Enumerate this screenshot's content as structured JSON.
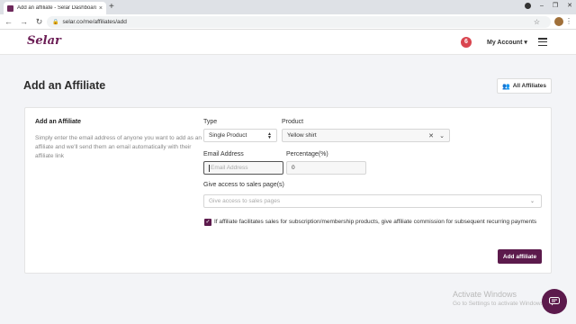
{
  "browser": {
    "tab_title": "Add an affiliate - Selar Dashboard",
    "tab_close": "×",
    "new_tab": "+",
    "url": "selar.co/me/affiliates/add",
    "back": "←",
    "forward": "→",
    "reload": "↻",
    "lock": "🔒",
    "star": "☆",
    "kebab": "⋮",
    "win_minimize": "–",
    "win_maximize": "❐",
    "win_close": "✕"
  },
  "header": {
    "logo": "Selar",
    "notification_count": "6",
    "account_label": "My Account ▾"
  },
  "page": {
    "title": "Add an Affiliate",
    "all_affiliates_label": "All Affiliates",
    "users_icon": "👥"
  },
  "form": {
    "section_title": "Add an Affiliate",
    "description": "Simply enter the email address of anyone you want to add as an affiliate and we'll send them an email automatically with their affiliate link",
    "type_label": "Type",
    "type_value": "Single Product",
    "product_label": "Product",
    "product_value": "Yellow shirt",
    "clear_icon": "✕",
    "chevron": "⌄",
    "email_label": "Email Address",
    "email_placeholder": "Email Address",
    "percentage_label": "Percentage(%)",
    "percentage_value": "0",
    "sales_pages_label": "Give access to sales page(s)",
    "sales_pages_placeholder": "Give access to sales pages",
    "checkbox_checked": true,
    "checkbox_mark": "✓",
    "checkbox_text": "If affiliate facilitates sales for subscription/membership products, give affiliate commission for subsequent recurring payments",
    "submit_label": "Add affiliate"
  },
  "watermark": {
    "line1": "Activate Windows",
    "line2": "Go to Settings to activate Windows."
  },
  "colors": {
    "brand": "#5c1a4c",
    "notification": "#d9454f"
  }
}
